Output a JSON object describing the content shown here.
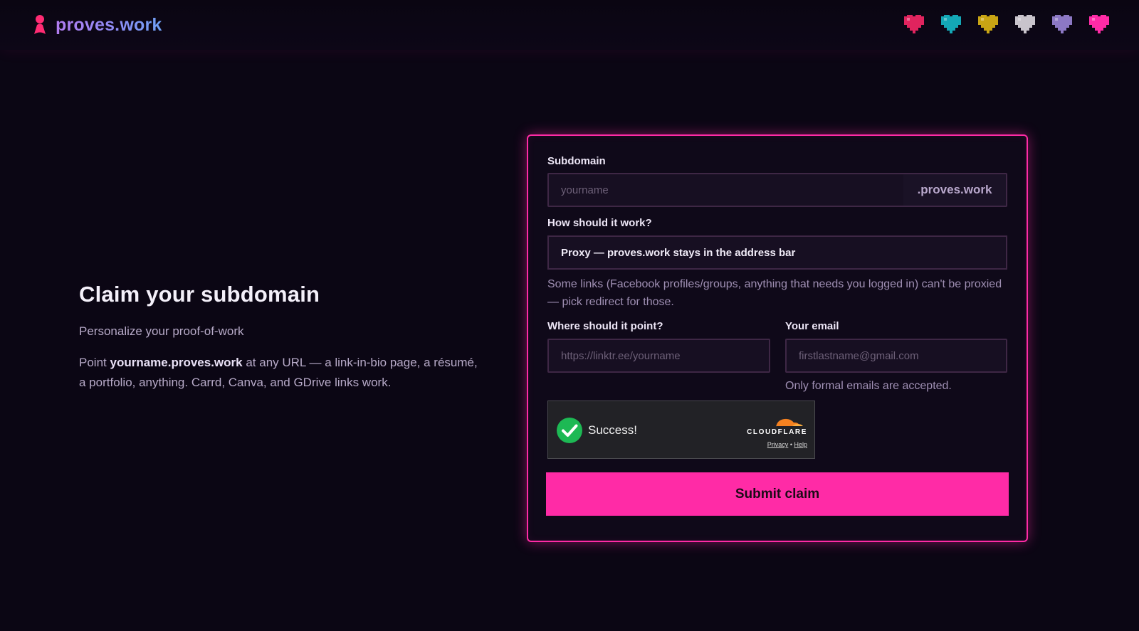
{
  "header": {
    "logo_text": "proves.work",
    "hearts": [
      {
        "name": "red",
        "color": "#e0245e"
      },
      {
        "name": "teal",
        "color": "#14a8b6"
      },
      {
        "name": "gold",
        "color": "#c9a514"
      },
      {
        "name": "silver",
        "color": "#c9c4cc"
      },
      {
        "name": "lavender",
        "color": "#8c78c4"
      },
      {
        "name": "pink",
        "color": "#ff2ba6"
      }
    ]
  },
  "hero": {
    "title": "Claim your subdomain",
    "subtitle": "Personalize your proof-of-work",
    "desc_prefix": "Point ",
    "desc_bold": "yourname.proves.work",
    "desc_suffix": " at any URL — a link-in-bio page, a résumé, a portfolio, anything. Carrd, Canva, and GDrive links work."
  },
  "form": {
    "subdomain_label": "Subdomain",
    "subdomain_placeholder": "yourname",
    "subdomain_suffix": ".proves.work",
    "mode_label": "How should it work?",
    "mode_selected": "Proxy — proves.work stays in the address bar",
    "mode_helper": "Some links (Facebook profiles/groups, anything that needs you logged in) can't be proxied — pick redirect for those.",
    "target_label": "Where should it point?",
    "target_placeholder": "https://linktr.ee/yourname",
    "email_label": "Your email",
    "email_placeholder": "firstlastname@gmail.com",
    "email_helper": "Only formal emails are accepted.",
    "submit_label": "Submit claim"
  },
  "turnstile": {
    "status": "Success!",
    "brand": "CLOUDFLARE",
    "privacy": "Privacy",
    "separator": "•",
    "help": "Help"
  },
  "colors": {
    "accent": "#ff2ba6",
    "background": "#0b0614",
    "success": "#1db954"
  }
}
